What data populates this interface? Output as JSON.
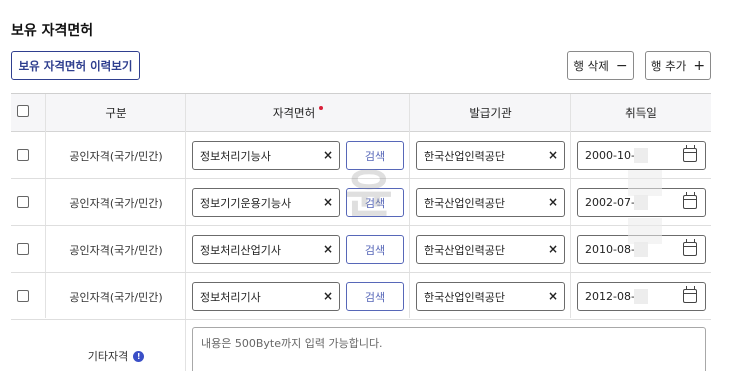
{
  "section_title": "보유 자격면허",
  "buttons": {
    "history": "보유 자격면허 이력보기",
    "delete_row": "행 삭제",
    "delete_symbol": "−",
    "add_row": "행 추가",
    "add_symbol": "+"
  },
  "table": {
    "headers": {
      "category": "구분",
      "license": "자격면허",
      "issuer": "발급기관",
      "acquired": "취득일"
    },
    "rows": [
      {
        "category": "공인자격(국가/민간)",
        "license": "정보처리기능사",
        "issuer": "한국산업인력공단",
        "date": "2000-10-"
      },
      {
        "category": "공인자격(국가/민간)",
        "license": "정보기기운용기능사",
        "issuer": "한국산업인력공단",
        "date": "2002-07-"
      },
      {
        "category": "공인자격(국가/민간)",
        "license": "정보처리산업기사",
        "issuer": "한국산업인력공단",
        "date": "2010-08-"
      },
      {
        "category": "공인자격(국가/민간)",
        "license": "정보처리기사",
        "issuer": "한국산업인력공단",
        "date": "2012-08-"
      }
    ],
    "search_label": "검색",
    "clear_symbol": "×"
  },
  "other": {
    "label": "기타자격",
    "info_symbol": "!",
    "placeholder": "내용은 500Byte까지 입력 가능합니다."
  },
  "watermark": "윤"
}
